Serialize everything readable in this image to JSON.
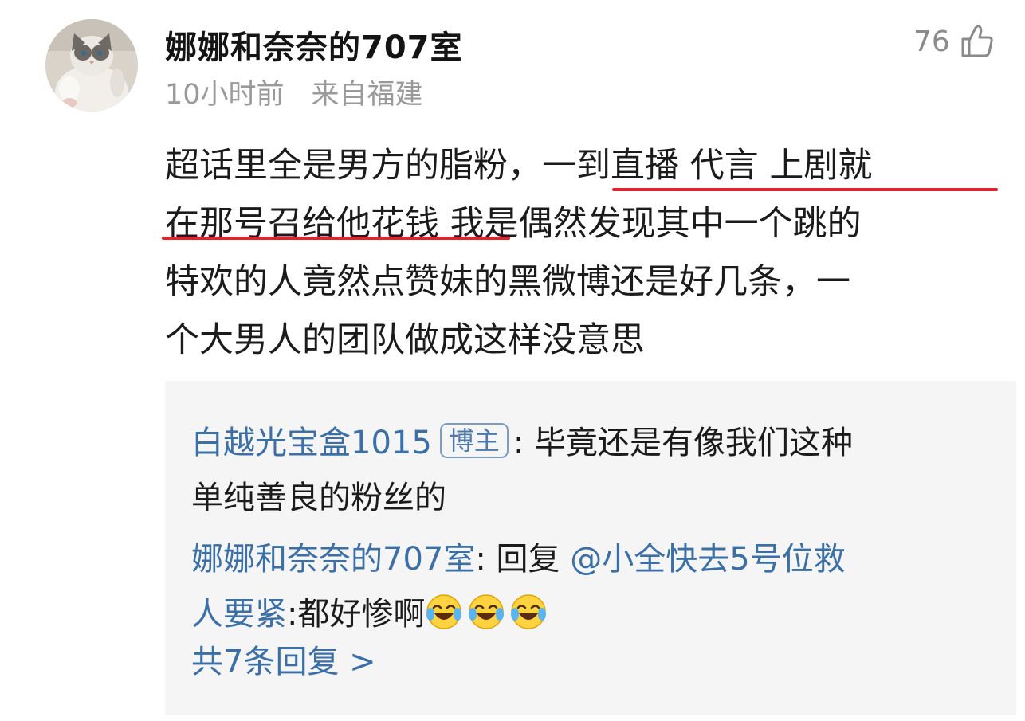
{
  "comment": {
    "username": "娜娜和奈奈的707室",
    "time": "10小时前",
    "location": "来自福建",
    "like_count": "76",
    "body_lines": [
      "超话里全是男方的脂粉，一到直播 代言 上剧就",
      "在那号召给他花钱 我是偶然发现其中一个跳的",
      "特欢的人竟然点赞妹的黑微博还是好几条，一",
      "个大男人的团队做成这样没意思"
    ],
    "highlight_color": "#e0232e"
  },
  "replies": [
    {
      "author": "白越光宝盒1015",
      "badge": "博主",
      "text_part1": ": 毕竟还是有像我们这种",
      "text_part2": "单纯善良的粉丝的"
    },
    {
      "author": "娜娜和奈奈的707室",
      "reply_prefix": ": 回复 ",
      "mention": "@小全快去5号位救",
      "mention_cont": "人要紧",
      "text": ":都好惨啊",
      "emojis": [
        "laughing-crying-emoji",
        "laughing-crying-emoji",
        "laughing-crying-emoji"
      ]
    }
  ],
  "more_replies": "共7条回复 >",
  "colors": {
    "link": "#3a6fa8",
    "meta": "#9a9a9a",
    "reply_background": "#f5f5f6"
  },
  "icons": {
    "like": "thumbs-up-icon"
  }
}
